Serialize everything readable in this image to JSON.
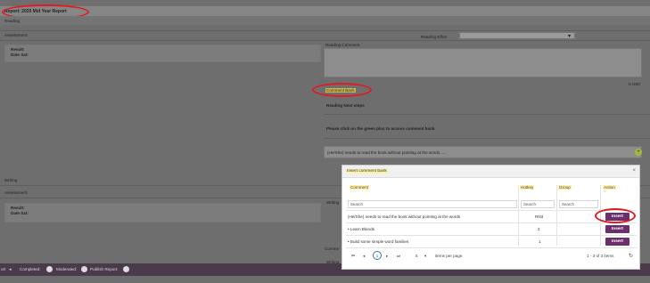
{
  "report": {
    "title": "Report: 2020 Mid Year Report"
  },
  "reading": {
    "section_label": "Reading",
    "assessment_label": "Assessment:",
    "result_label": "Result:",
    "date_sat_label": "Date Sat:",
    "effort_label": "Reading Effort",
    "comment_label": "Reading Comment",
    "char_count": "0 /400",
    "comment_bank_label": "Comment Bank",
    "next_steps_label": "Reading Next steps",
    "instruction": "Please click on the green plus to access comment bank",
    "next_steps_value": "(He/She) needs to read the book without pointing at the words......"
  },
  "writing": {
    "section_label": "Writing",
    "assessment_label": "Assessment:",
    "result_label": "Result:",
    "date_sat_label": "Date Sat:",
    "side_label_1": "Writing",
    "side_label_2": "Comme",
    "side_label_3": "Writing"
  },
  "footer": {
    "prev_label": "ort",
    "completed_label": "Completed:",
    "moderated_label": "Moderated:",
    "publish_label": "Publish Report:"
  },
  "modal": {
    "title": "Insert comment bank",
    "close_glyph": "×",
    "columns": [
      "Comment",
      "Hotkey",
      "Group",
      "Action"
    ],
    "search_placeholder": "Search",
    "rows": [
      {
        "comment": "(He/She) needs to read the book without pointing at the words",
        "hotkey": "RN3",
        "group": "",
        "action": "Insert"
      },
      {
        "comment": "• Learn Blends",
        "hotkey": "2",
        "group": "",
        "action": "Insert"
      },
      {
        "comment": "• Build some simple word families",
        "hotkey": "1",
        "group": "",
        "action": "Insert"
      }
    ],
    "pager": {
      "first": "⏮",
      "prev": "◂",
      "current": "1",
      "next": "▸",
      "last": "⏭",
      "page_size": "5",
      "per_page_label": "items per page",
      "summary": "1 - 3 of 3 items",
      "refresh": "↻"
    }
  },
  "colors": {
    "annotation": "#e01b24",
    "insert_button": "#6b2f6b",
    "highlight": "#fff2a8",
    "plus": "#a8b83a"
  }
}
